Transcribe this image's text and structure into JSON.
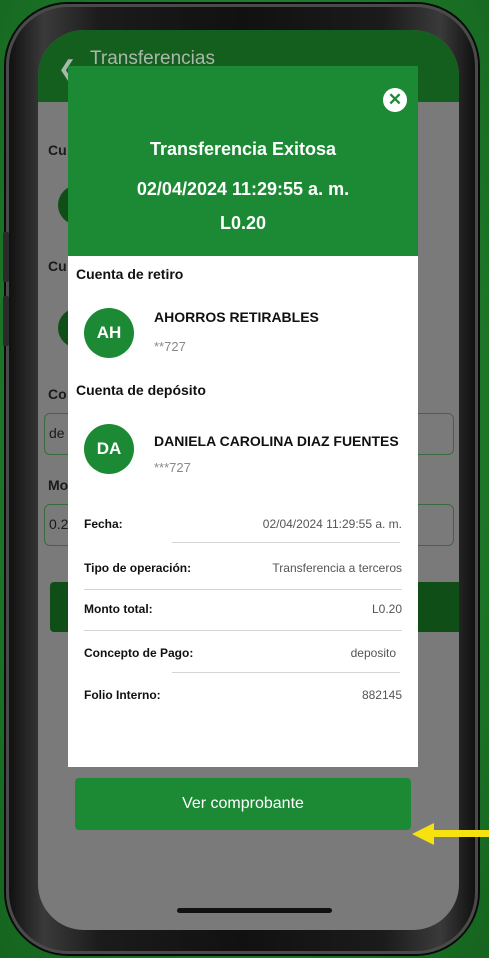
{
  "background_app": {
    "title": "Transferencias",
    "labels": [
      "Cu",
      "Cu",
      "Co",
      "Mo"
    ],
    "field_values": [
      "de",
      "0.2"
    ]
  },
  "modal": {
    "header": {
      "status": "Transferencia Exitosa",
      "datetime": "02/04/2024 11:29:55 a. m.",
      "amount": "L0.20"
    },
    "withdraw": {
      "section_title": "Cuenta de retiro",
      "initials": "AH",
      "name": "AHORROS RETIRABLES",
      "number": "**727"
    },
    "deposit": {
      "section_title": "Cuenta de depósito",
      "initials": "DA",
      "name": "DANIELA CAROLINA DIAZ FUENTES",
      "number": "***727"
    },
    "details": [
      {
        "label": "Fecha:",
        "value": "02/04/2024 11:29:55 a. m."
      },
      {
        "label": "Tipo de operación:",
        "value": "Transferencia a terceros"
      },
      {
        "label": "Monto total:",
        "value": "L0.20"
      },
      {
        "label": "Concepto de Pago:",
        "value": "deposito"
      },
      {
        "label": "Folio Interno:",
        "value": "882145"
      }
    ],
    "cta_label": "Ver comprobante"
  },
  "colors": {
    "brand_green": "#1c8a34",
    "annotation_arrow": "#f5e20e"
  },
  "icons": [
    "close-circle-icon",
    "back-arrow-icon",
    "annotation-arrow-icon"
  ]
}
